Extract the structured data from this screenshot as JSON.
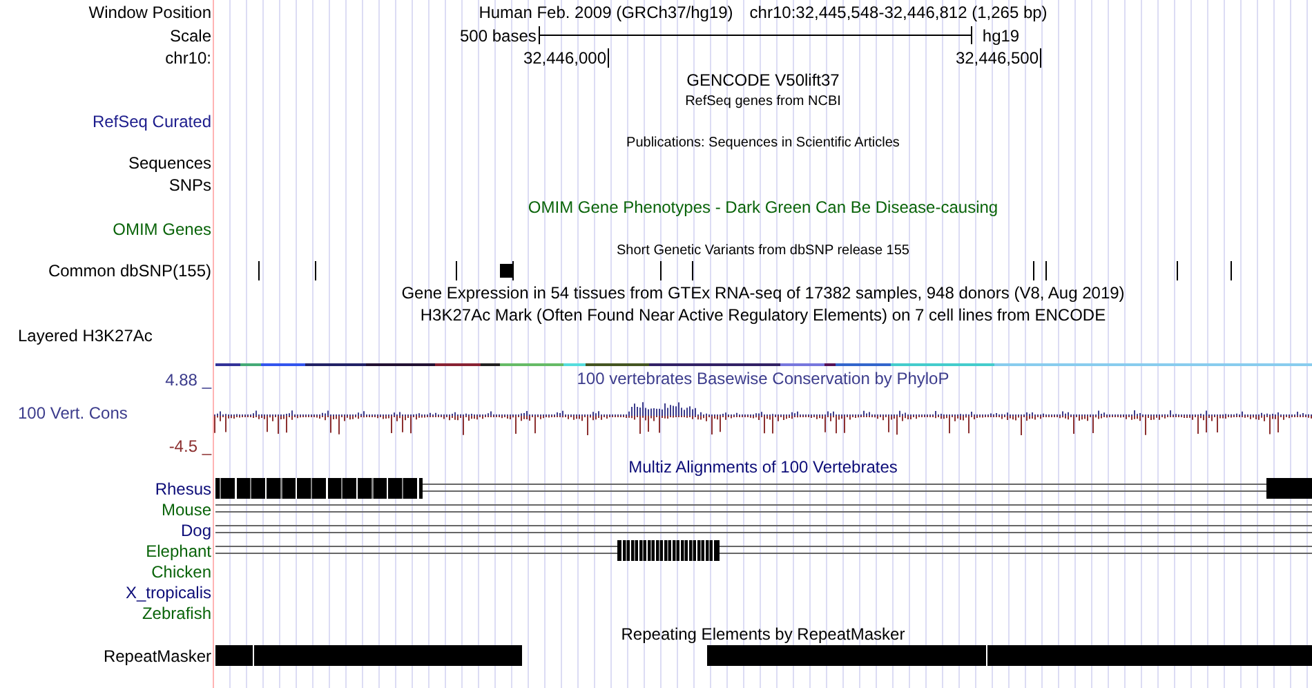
{
  "header": {
    "assembly": "Human Feb. 2009 (GRCh37/hg19)",
    "position": "chr10:32,445,548-32,446,812 (1,265 bp)"
  },
  "rows": [
    {
      "kind": "position",
      "label": "Window Position"
    },
    {
      "kind": "scale",
      "label": "Scale",
      "text": "500 bases",
      "assembly": "hg19"
    },
    {
      "kind": "ruler",
      "label": "chr10:",
      "ticks": [
        "32,446,000",
        "32,446,500"
      ]
    },
    {
      "kind": "title",
      "text": "GENCODE V50lift37",
      "color": "#000000"
    },
    {
      "kind": "note",
      "text": "RefSeq genes from NCBI"
    },
    {
      "kind": "label",
      "label": "RefSeq Curated",
      "color": "#1c1c8c"
    },
    {
      "kind": "note",
      "text": "Publications: Sequences in Scientific Articles"
    },
    {
      "kind": "label",
      "label": "Sequences",
      "color": "#000000"
    },
    {
      "kind": "label",
      "label": "SNPs",
      "color": "#000000"
    },
    {
      "kind": "title",
      "text": "OMIM Gene Phenotypes - Dark Green Can Be Disease-causing",
      "color": "#0a640a"
    },
    {
      "kind": "label",
      "label": "OMIM Genes",
      "color": "#0a640a"
    },
    {
      "kind": "note",
      "text": "Short Genetic Variants from dbSNP release 155"
    },
    {
      "kind": "snps",
      "label": "Common dbSNP(155)",
      "color": "#000000"
    },
    {
      "kind": "title",
      "text": "Gene Expression in 54 tissues from GTEx RNA-seq of 17382 samples, 948 donors (V8, Aug 2019)",
      "color": "#000000"
    },
    {
      "kind": "title",
      "text": "H3K27Ac Mark (Often Found Near Active Regulatory Elements) on 7 cell lines from ENCODE",
      "color": "#000000"
    },
    {
      "kind": "side_label",
      "label": "Layered H3K27Ac",
      "color": "#000000"
    },
    {
      "kind": "band"
    },
    {
      "kind": "conservation",
      "label": "100 Vert. Cons",
      "max": "4.88 _",
      "min": "-4.5 _",
      "text": "100 vertebrates Basewise Conservation by PhyloP",
      "color": "#3c3c8c"
    },
    {
      "kind": "title",
      "text": "Multiz Alignments of 100 Vertebrates",
      "color": "#0c0c78"
    },
    {
      "kind": "species",
      "label": "Rhesus",
      "color": "#0c0c78",
      "alignment": {
        "kind": "ends"
      }
    },
    {
      "kind": "species",
      "label": "Mouse",
      "color": "#0a640a",
      "alignment": {
        "kind": "lines"
      }
    },
    {
      "kind": "species",
      "label": "Dog",
      "color": "#0c0c78",
      "alignment": {
        "kind": "lines"
      }
    },
    {
      "kind": "species",
      "label": "Elephant",
      "color": "#0a640a",
      "alignment": {
        "kind": "middle"
      }
    },
    {
      "kind": "species",
      "label": "Chicken",
      "color": "#0a640a",
      "alignment": {
        "kind": "none"
      }
    },
    {
      "kind": "species",
      "label": "X_tropicalis",
      "color": "#0c0c78",
      "alignment": {
        "kind": "none"
      }
    },
    {
      "kind": "species",
      "label": "Zebrafish",
      "color": "#0a640a",
      "alignment": {
        "kind": "none"
      }
    },
    {
      "kind": "title",
      "text": "Repeating Elements by RepeatMasker",
      "color": "#000000"
    },
    {
      "kind": "repeats",
      "label": "RepeatMasker",
      "color": "#000000"
    }
  ]
}
